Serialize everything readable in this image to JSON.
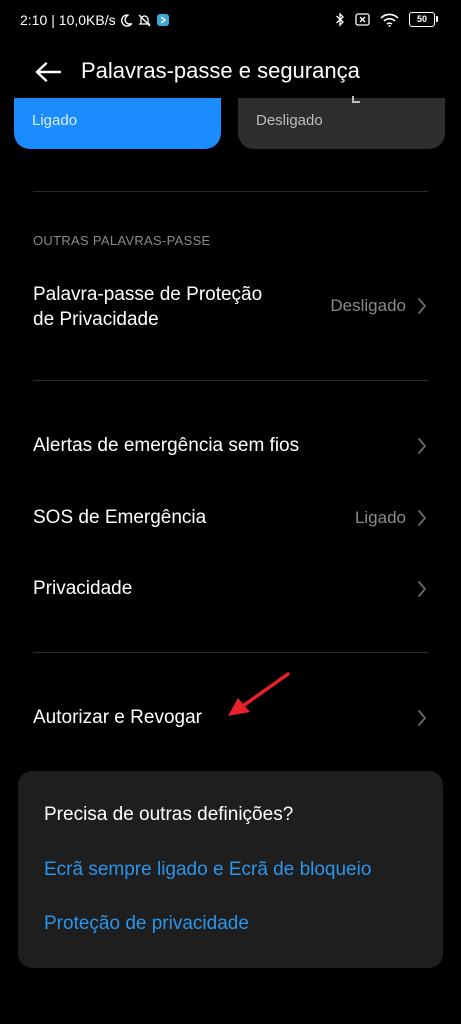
{
  "status_bar": {
    "time": "2:10",
    "speed": "| 10,0KB/s",
    "battery": "50"
  },
  "header": {
    "title": "Palavras-passe e segurança"
  },
  "top_cards": {
    "left_status": "Ligado",
    "right_status": "Desligado"
  },
  "sections": {
    "other_passwords": {
      "header": "OUTRAS PALAVRAS-PASSE",
      "privacy_password": {
        "label_line1": "Palavra-passe de Proteção",
        "label_line2": "de Privacidade",
        "value": "Desligado"
      }
    },
    "emergency": {
      "wireless_alerts": {
        "label": "Alertas de emergência sem fios"
      },
      "sos": {
        "label": "SOS de Emergência",
        "value": "Ligado"
      },
      "privacy": {
        "label": "Privacidade"
      }
    },
    "authorize": {
      "label": "Autorizar e Revogar"
    }
  },
  "suggestions": {
    "title": "Precisa de outras definições?",
    "links": [
      "Ecrã sempre ligado e Ecrã de bloqueio",
      "Proteção de privacidade"
    ]
  },
  "colors": {
    "background": "#000000",
    "accent_blue": "#1a8cff",
    "link_blue": "#2b95ea",
    "secondary_text": "#8a8a8a",
    "annotation_red": "#e8202a"
  }
}
